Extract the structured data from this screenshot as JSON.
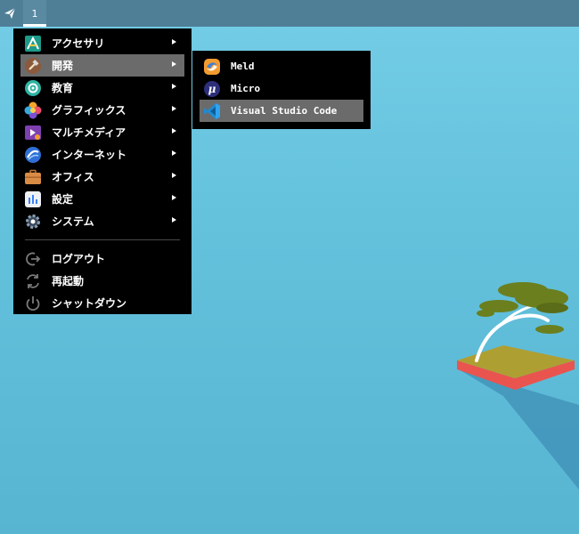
{
  "panel": {
    "workspace": "1",
    "launcher_icon": "paper-plane-icon"
  },
  "menu": {
    "categories": [
      {
        "label": "アクセサリ",
        "icon": "accessories-icon",
        "active": false
      },
      {
        "label": "開発",
        "icon": "development-hammer-icon",
        "active": true
      },
      {
        "label": "教育",
        "icon": "education-icon",
        "active": false
      },
      {
        "label": "グラフィックス",
        "icon": "graphics-icon",
        "active": false
      },
      {
        "label": "マルチメディア",
        "icon": "multimedia-icon",
        "active": false
      },
      {
        "label": "インターネット",
        "icon": "internet-icon",
        "active": false
      },
      {
        "label": "オフィス",
        "icon": "office-briefcase-icon",
        "active": false
      },
      {
        "label": "設定",
        "icon": "settings-icon",
        "active": false
      },
      {
        "label": "システム",
        "icon": "system-gear-icon",
        "active": false
      }
    ],
    "actions": [
      {
        "label": "ログアウト",
        "icon": "logout-icon"
      },
      {
        "label": "再起動",
        "icon": "restart-icon"
      },
      {
        "label": "シャットダウン",
        "icon": "power-icon"
      }
    ]
  },
  "submenu": {
    "items": [
      {
        "label": "Meld",
        "icon": "meld-icon",
        "active": false
      },
      {
        "label": "Micro",
        "icon": "micro-icon",
        "active": false
      },
      {
        "label": "Visual Studio Code",
        "icon": "vscode-icon",
        "active": true
      }
    ]
  },
  "colors": {
    "panel": "#4f7f97",
    "menu_bg": "#000000",
    "highlight": "#6b6b6b",
    "desktop": "#6ac8e2"
  }
}
